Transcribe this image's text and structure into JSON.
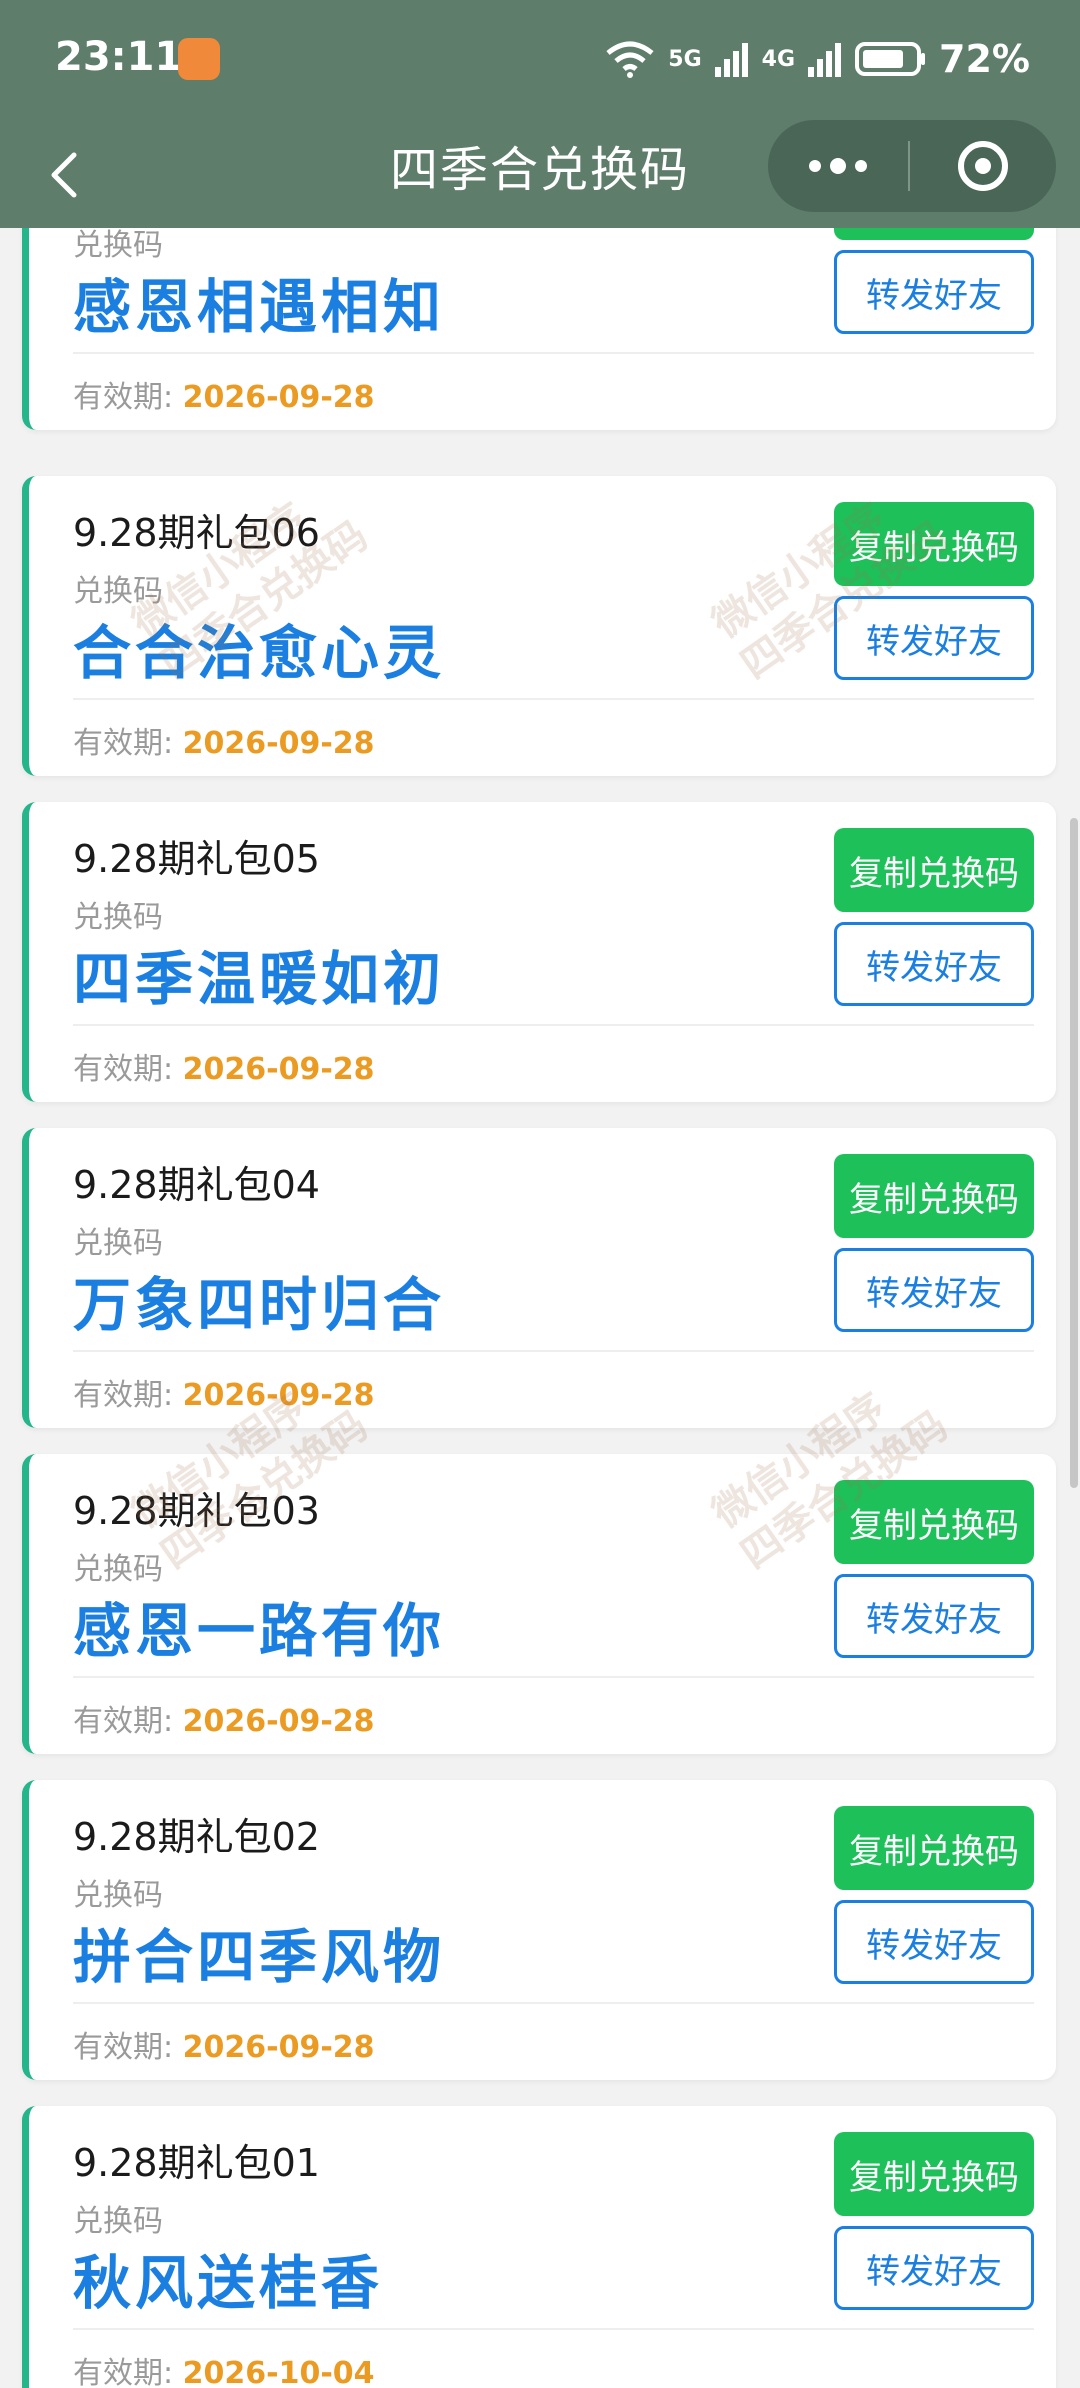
{
  "status_bar": {
    "time": "23:11",
    "network_5g": "5G",
    "network_4g": "4G",
    "battery": "72%"
  },
  "nav": {
    "title": "四季合兑换码"
  },
  "labels": {
    "code_label": "兑换码",
    "validity_prefix": "有效期: ",
    "copy_button": "复制兑换码",
    "forward_button": "转发好友"
  },
  "watermark": {
    "line1": "微信小程序",
    "line2": "四季合兑换码"
  },
  "cards": [
    {
      "package": "",
      "code": "感恩相遇相知",
      "validity": "2026-09-28"
    },
    {
      "package": "9.28期礼包06",
      "code": "合合治愈心灵",
      "validity": "2026-09-28"
    },
    {
      "package": "9.28期礼包05",
      "code": "四季温暖如初",
      "validity": "2026-09-28"
    },
    {
      "package": "9.28期礼包04",
      "code": "万象四时归合",
      "validity": "2026-09-28"
    },
    {
      "package": "9.28期礼包03",
      "code": "感恩一路有你",
      "validity": "2026-09-28"
    },
    {
      "package": "9.28期礼包02",
      "code": "拼合四季风物",
      "validity": "2026-09-28"
    },
    {
      "package": "9.28期礼包01",
      "code": "秋风送桂香",
      "validity": "2026-10-04"
    }
  ],
  "colors": {
    "header": "#5e7d6a",
    "accent_green": "#1ec05a",
    "code_blue": "#1a7fe0",
    "date_orange": "#eb9a22"
  }
}
